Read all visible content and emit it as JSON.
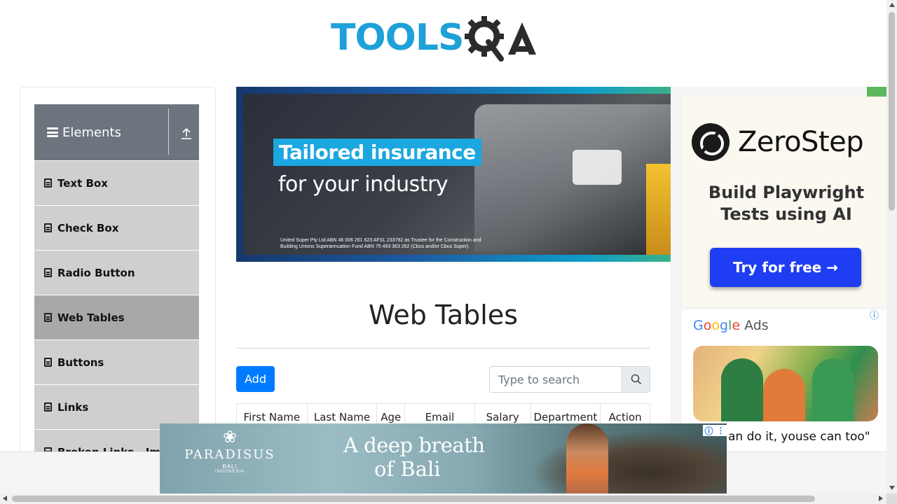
{
  "header": {
    "logo_text": "TOOLS",
    "logo_qa": "QA"
  },
  "sidebar": {
    "group_title": "Elements",
    "items": [
      {
        "label": "Text Box"
      },
      {
        "label": "Check Box"
      },
      {
        "label": "Radio Button"
      },
      {
        "label": "Web Tables",
        "active": true
      },
      {
        "label": "Buttons"
      },
      {
        "label": "Links"
      },
      {
        "label": "Broken Links - Images"
      }
    ]
  },
  "banner_ad": {
    "headline": "Tailored insurance",
    "subline": "for your industry",
    "fine_print": "United Super Pty Ltd ABN 46 006 261 623 AFSL 233792 as Trustee for the Construction and Building Unions Superannuation Fund ABN 75 493 363 262 (Cbus and/or Cbus Super)."
  },
  "right_ad": {
    "brand": "ZeroStep",
    "tagline": "Build Playwright Tests using AI",
    "button": "Try for free →",
    "google_ads_label": "Google Ads",
    "caption": "an do it, youse can too\""
  },
  "main": {
    "title": "Web Tables",
    "add_button": "Add",
    "search": {
      "placeholder": "Type to search",
      "value": ""
    },
    "table": {
      "columns": [
        "First Name",
        "Last Name",
        "Age",
        "Email",
        "Salary",
        "Department",
        "Action"
      ]
    }
  },
  "bottom_ad": {
    "brand": "PARADISUS",
    "brand_sub": "BALI",
    "brand_sub2": "INDONESIA",
    "line1": "A deep breath",
    "line2": "of Bali"
  },
  "colors": {
    "accent": "#007bff",
    "sidebar_header": "#6c757d",
    "logo_blue": "#1da1d8",
    "zerostep_button": "#1f3df2"
  }
}
